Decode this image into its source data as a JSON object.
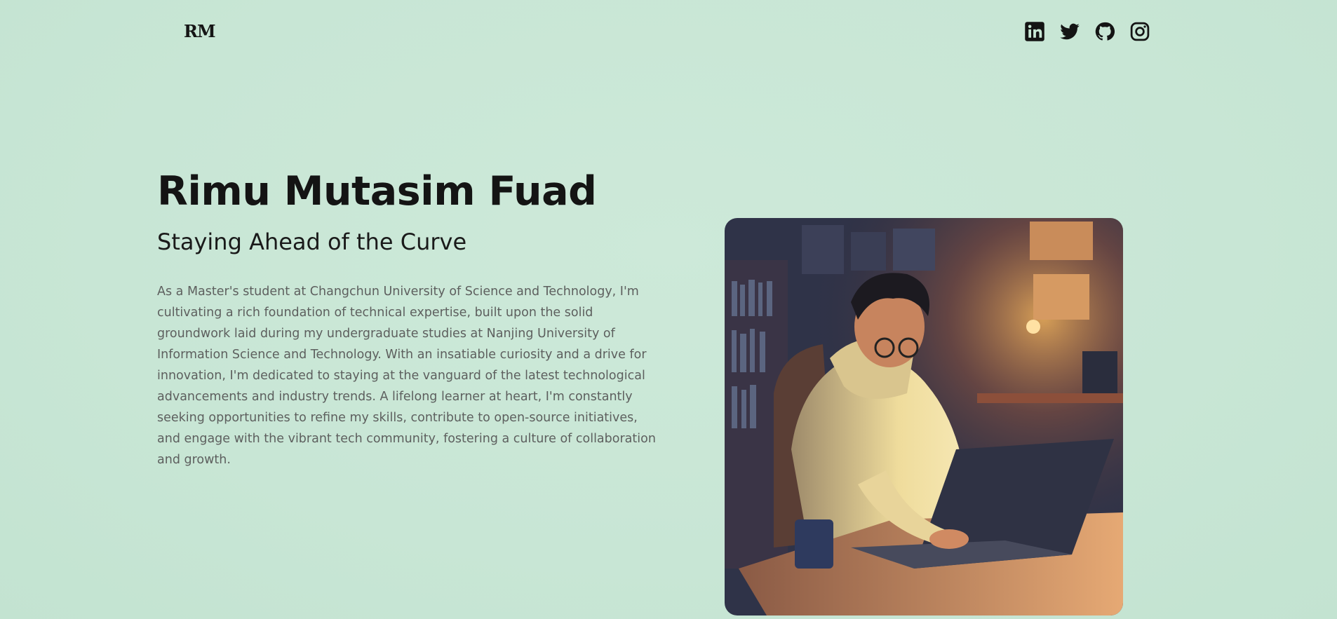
{
  "header": {
    "logo_text": "RM",
    "social_links": [
      {
        "icon": "linkedin-icon",
        "label": "LinkedIn"
      },
      {
        "icon": "twitter-icon",
        "label": "Twitter"
      },
      {
        "icon": "github-icon",
        "label": "GitHub"
      },
      {
        "icon": "instagram-icon",
        "label": "Instagram"
      }
    ]
  },
  "hero": {
    "name": "Rimu Mutasim Fuad",
    "tagline": "Staying Ahead of the Curve",
    "bio": "As a Master's student at Changchun University of Science and Technology, I'm cultivating a rich foundation of technical expertise, built upon the solid groundwork laid during my undergraduate studies at Nanjing University of Information Science and Technology. With an insatiable curiosity and a drive for innovation, I'm dedicated to staying at the vanguard of the latest technological advancements and industry trends. A lifelong learner at heart, I'm constantly seeking opportunities to refine my skills, contribute to open-source initiatives, and engage with the vibrant tech community, fostering a culture of collaboration and growth."
  },
  "colors": {
    "background": "#c9e8d6",
    "text_primary": "#141414",
    "text_secondary": "#5d5f5e"
  }
}
